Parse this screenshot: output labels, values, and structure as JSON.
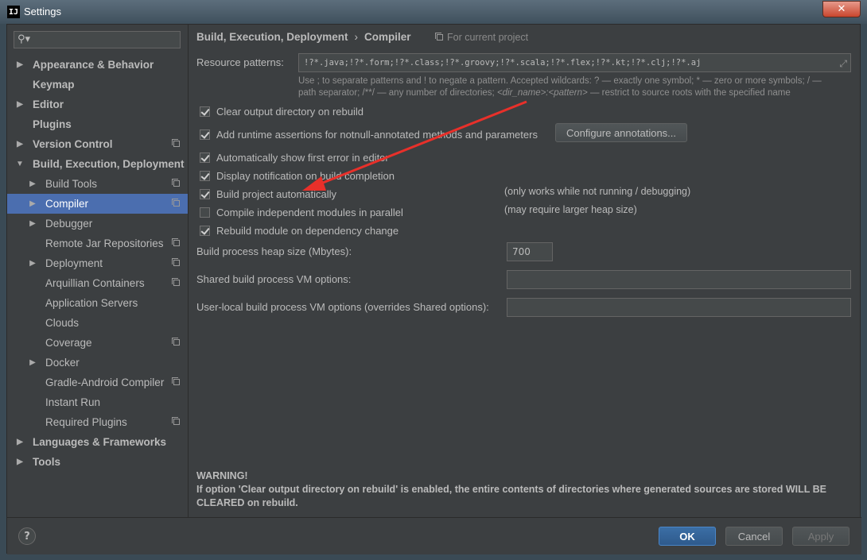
{
  "window": {
    "title": "Settings",
    "app_icon": "IJ"
  },
  "search": {
    "placeholder": ""
  },
  "sidebar": {
    "items": [
      {
        "label": "Appearance & Behavior",
        "level": 0,
        "arrow": "right",
        "bold": true
      },
      {
        "label": "Keymap",
        "level": 0,
        "arrow": "none",
        "bold": true
      },
      {
        "label": "Editor",
        "level": 0,
        "arrow": "right",
        "bold": true
      },
      {
        "label": "Plugins",
        "level": 0,
        "arrow": "none",
        "bold": true
      },
      {
        "label": "Version Control",
        "level": 0,
        "arrow": "right",
        "bold": true,
        "copy": true
      },
      {
        "label": "Build, Execution, Deployment",
        "level": 0,
        "arrow": "down",
        "bold": true
      },
      {
        "label": "Build Tools",
        "level": 1,
        "arrow": "right",
        "copy": true
      },
      {
        "label": "Compiler",
        "level": 1,
        "arrow": "right",
        "copy": true,
        "selected": true
      },
      {
        "label": "Debugger",
        "level": 1,
        "arrow": "right"
      },
      {
        "label": "Remote Jar Repositories",
        "level": 1,
        "arrow": "none",
        "copy": true
      },
      {
        "label": "Deployment",
        "level": 1,
        "arrow": "right",
        "copy": true
      },
      {
        "label": "Arquillian Containers",
        "level": 1,
        "arrow": "none",
        "copy": true
      },
      {
        "label": "Application Servers",
        "level": 1,
        "arrow": "none"
      },
      {
        "label": "Clouds",
        "level": 1,
        "arrow": "none"
      },
      {
        "label": "Coverage",
        "level": 1,
        "arrow": "none",
        "copy": true
      },
      {
        "label": "Docker",
        "level": 1,
        "arrow": "right"
      },
      {
        "label": "Gradle-Android Compiler",
        "level": 1,
        "arrow": "none",
        "copy": true
      },
      {
        "label": "Instant Run",
        "level": 1,
        "arrow": "none"
      },
      {
        "label": "Required Plugins",
        "level": 1,
        "arrow": "none",
        "copy": true
      },
      {
        "label": "Languages & Frameworks",
        "level": 0,
        "arrow": "right",
        "bold": true
      },
      {
        "label": "Tools",
        "level": 0,
        "arrow": "right",
        "bold": true
      }
    ]
  },
  "breadcrumb": {
    "parent": "Build, Execution, Deployment",
    "separator": "›",
    "current": "Compiler"
  },
  "scope_label": "For current project",
  "resource": {
    "label": "Resource patterns:",
    "value": "!?*.java;!?*.form;!?*.class;!?*.groovy;!?*.scala;!?*.flex;!?*.kt;!?*.clj;!?*.aj",
    "hint_line1": "Use ; to separate patterns and ! to negate a pattern. Accepted wildcards: ? — exactly one symbol; * — zero or more symbols; / —",
    "hint_line2a": "path separator; /**/ — any number of directories; ",
    "hint_line2b": "<dir_name>:<pattern>",
    "hint_line2c": " — restrict to source roots with the specified name"
  },
  "checkboxes": [
    {
      "label": "Clear output directory on rebuild",
      "checked": true
    },
    {
      "label": "Add runtime assertions for notnull-annotated methods and parameters",
      "checked": true
    },
    {
      "label": "Automatically show first error in editor",
      "checked": true
    },
    {
      "label": "Display notification on build completion",
      "checked": true
    },
    {
      "label": "Build project automatically",
      "checked": true
    },
    {
      "label": "Compile independent modules in parallel",
      "checked": false
    },
    {
      "label": "Rebuild module on dependency change",
      "checked": true
    }
  ],
  "configure_button": "Configure annotations...",
  "notes": {
    "build_auto": "(only works while not running / debugging)",
    "parallel": "(may require larger heap size)"
  },
  "heap": {
    "label": "Build process heap size (Mbytes):",
    "value": "700"
  },
  "shared_vm": {
    "label": "Shared build process VM options:",
    "value": ""
  },
  "user_vm": {
    "label": "User-local build process VM options (overrides Shared options):",
    "value": ""
  },
  "warning": {
    "title": "WARNING!",
    "body": "If option 'Clear output directory on rebuild' is enabled, the entire contents of directories where generated sources are stored WILL BE CLEARED on rebuild."
  },
  "footer": {
    "help": "?",
    "ok": "OK",
    "cancel": "Cancel",
    "apply": "Apply"
  },
  "colors": {
    "selection": "#4b6eaf",
    "annotation_arrow": "#e8302a",
    "panel": "#3c3f41"
  }
}
